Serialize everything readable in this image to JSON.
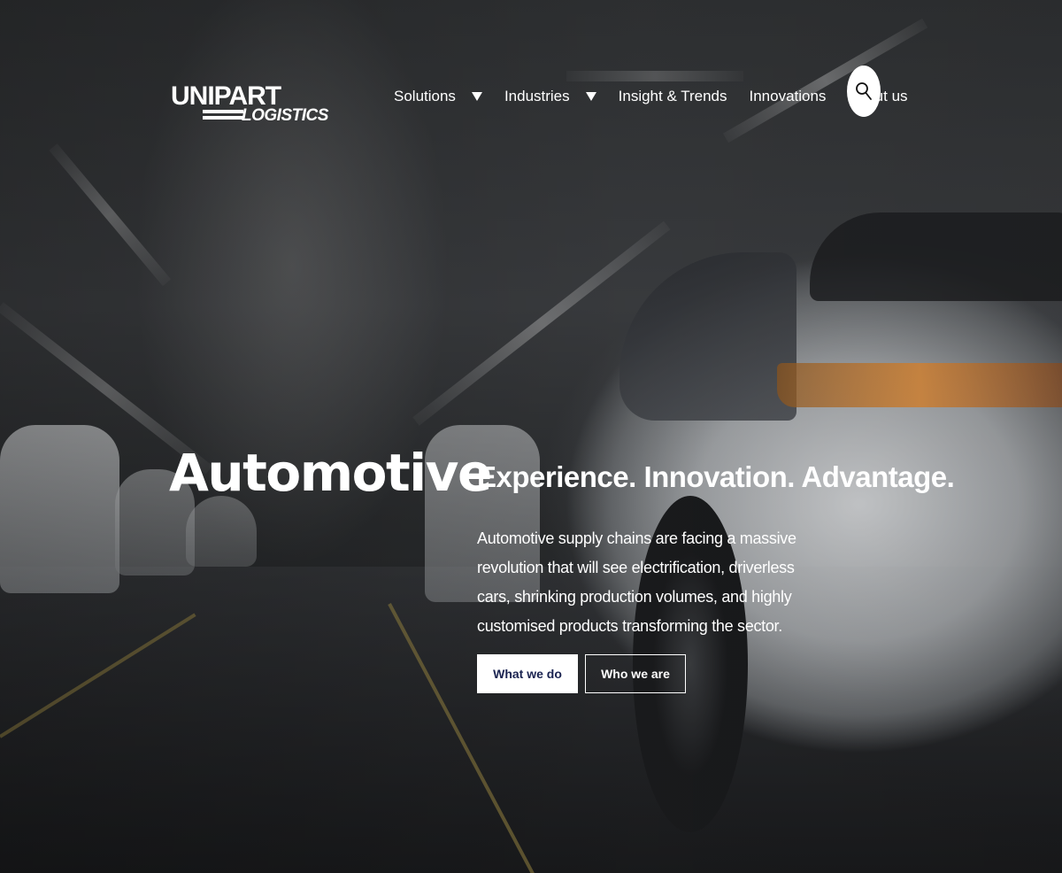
{
  "brand": {
    "logo_top": "UNIPART",
    "logo_bottom": "LOGISTICS"
  },
  "nav": {
    "items": [
      {
        "label": "Solutions",
        "has_dropdown": true
      },
      {
        "label": "Industries",
        "has_dropdown": true
      },
      {
        "label": "Insight & Trends",
        "has_dropdown": false
      },
      {
        "label": "Innovations",
        "has_dropdown": false
      },
      {
        "label": "About us",
        "has_dropdown": false
      }
    ],
    "search_icon": "search-icon"
  },
  "hero": {
    "title": "Automotive",
    "tagline": "Experience. Innovation. Advantage.",
    "description": "Automotive supply chains are facing a massive revolution that will see electrification, driverless cars, shrinking production volumes, and highly customised products transforming the sector.",
    "buttons": {
      "primary": "What we do",
      "secondary": "Who we are"
    }
  },
  "colors": {
    "text": "#ffffff",
    "button_text_primary": "#1a2350",
    "button_bg_primary": "#ffffff"
  }
}
